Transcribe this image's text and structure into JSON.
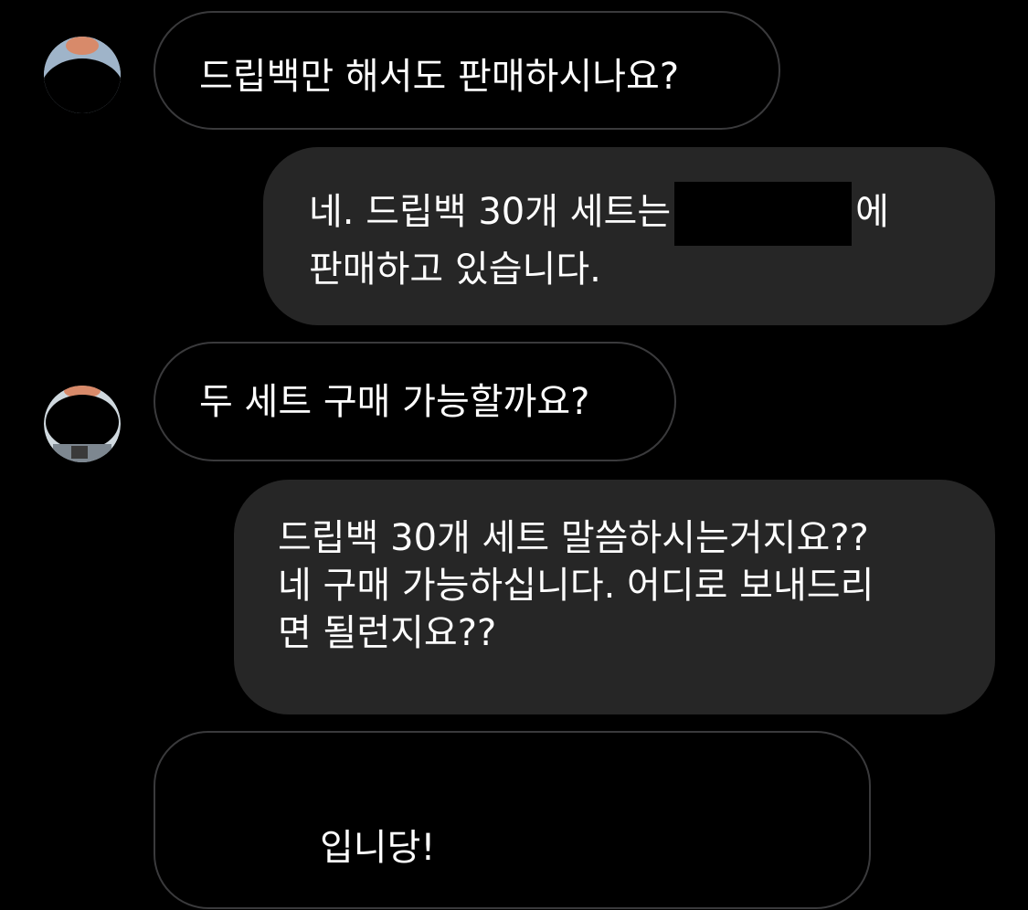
{
  "messages": [
    {
      "side": "incoming",
      "lines": [
        "드립백만 해서도 판매하시나요?"
      ]
    },
    {
      "side": "outgoing",
      "lines": [
        "네. 드립백 30개 세트는",
        "에",
        "판매하고 있습니다."
      ]
    },
    {
      "side": "incoming",
      "lines": [
        "두 세트 구매 가능할까요?"
      ]
    },
    {
      "side": "outgoing",
      "lines": [
        "드립백 30개 세트 말씀하시는거지요??",
        "네 구매 가능하십니다. 어디로 보내드리",
        "면 될런지요??"
      ]
    },
    {
      "side": "incoming",
      "lines": [
        "입니당!"
      ]
    }
  ],
  "colors": {
    "background": "#000000",
    "outgoing_bubble": "#262626",
    "incoming_border": "#3a3a3c",
    "text": "#ffffff"
  }
}
